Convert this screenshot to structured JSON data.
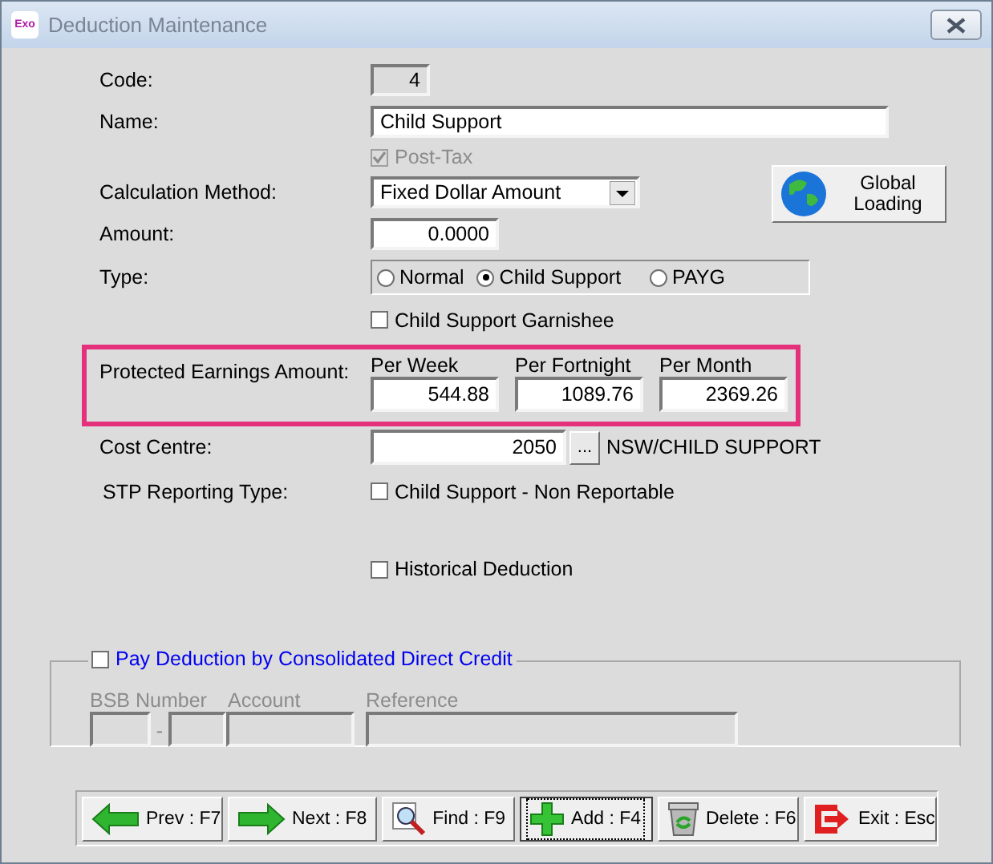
{
  "window": {
    "title": "Deduction Maintenance",
    "app_badge": "Exo"
  },
  "code": {
    "label": "Code:",
    "value": "4",
    "disabled": true
  },
  "name": {
    "label": "Name:",
    "value": "Child Support"
  },
  "post_tax": {
    "label": "Post-Tax",
    "checked": true,
    "disabled": true
  },
  "calculation_method": {
    "label": "Calculation Method:",
    "value": "Fixed Dollar Amount"
  },
  "global_loading_button": {
    "label": "Global Loading"
  },
  "amount": {
    "label": "Amount:",
    "value": "0.0000"
  },
  "type": {
    "label": "Type:",
    "options": [
      {
        "label": "Normal",
        "selected": false
      },
      {
        "label": "Child Support",
        "selected": true
      },
      {
        "label": "PAYG",
        "selected": false
      }
    ]
  },
  "child_support_garnishee": {
    "label": "Child Support Garnishee",
    "checked": false
  },
  "protected_earnings": {
    "label": "Protected Earnings Amount:",
    "highlighted": true,
    "columns": [
      {
        "label": "Per Week",
        "value": "544.88"
      },
      {
        "label": "Per Fortnight",
        "value": "1089.76"
      },
      {
        "label": "Per Month",
        "value": "2369.26"
      }
    ]
  },
  "cost_centre": {
    "label": "Cost Centre:",
    "value": "2050",
    "button": "...",
    "description": "NSW/CHILD SUPPORT"
  },
  "stp_reporting_type": {
    "label": "STP Reporting Type:",
    "option": {
      "label": "Child Support - Non Reportable",
      "checked": false
    }
  },
  "historical_deduction": {
    "label": "Historical Deduction",
    "checked": false
  },
  "direct_credit": {
    "label": "Pay Deduction by Consolidated Direct Credit",
    "checked": false,
    "fields_disabled": true,
    "bsb_label": "BSB Number",
    "bsb_separator": "-",
    "account_label": "Account",
    "reference_label": "Reference"
  },
  "buttons": [
    {
      "kind": "prev",
      "label": "Prev : F7",
      "focused": false
    },
    {
      "kind": "next",
      "label": "Next : F8",
      "focused": false
    },
    {
      "kind": "find",
      "label": "Find : F9",
      "focused": false
    },
    {
      "kind": "add",
      "label": "Add : F4",
      "focused": true
    },
    {
      "kind": "delete",
      "label": "Delete : F6",
      "focused": false
    },
    {
      "kind": "exit",
      "label": "Exit : Esc",
      "focused": false
    }
  ]
}
